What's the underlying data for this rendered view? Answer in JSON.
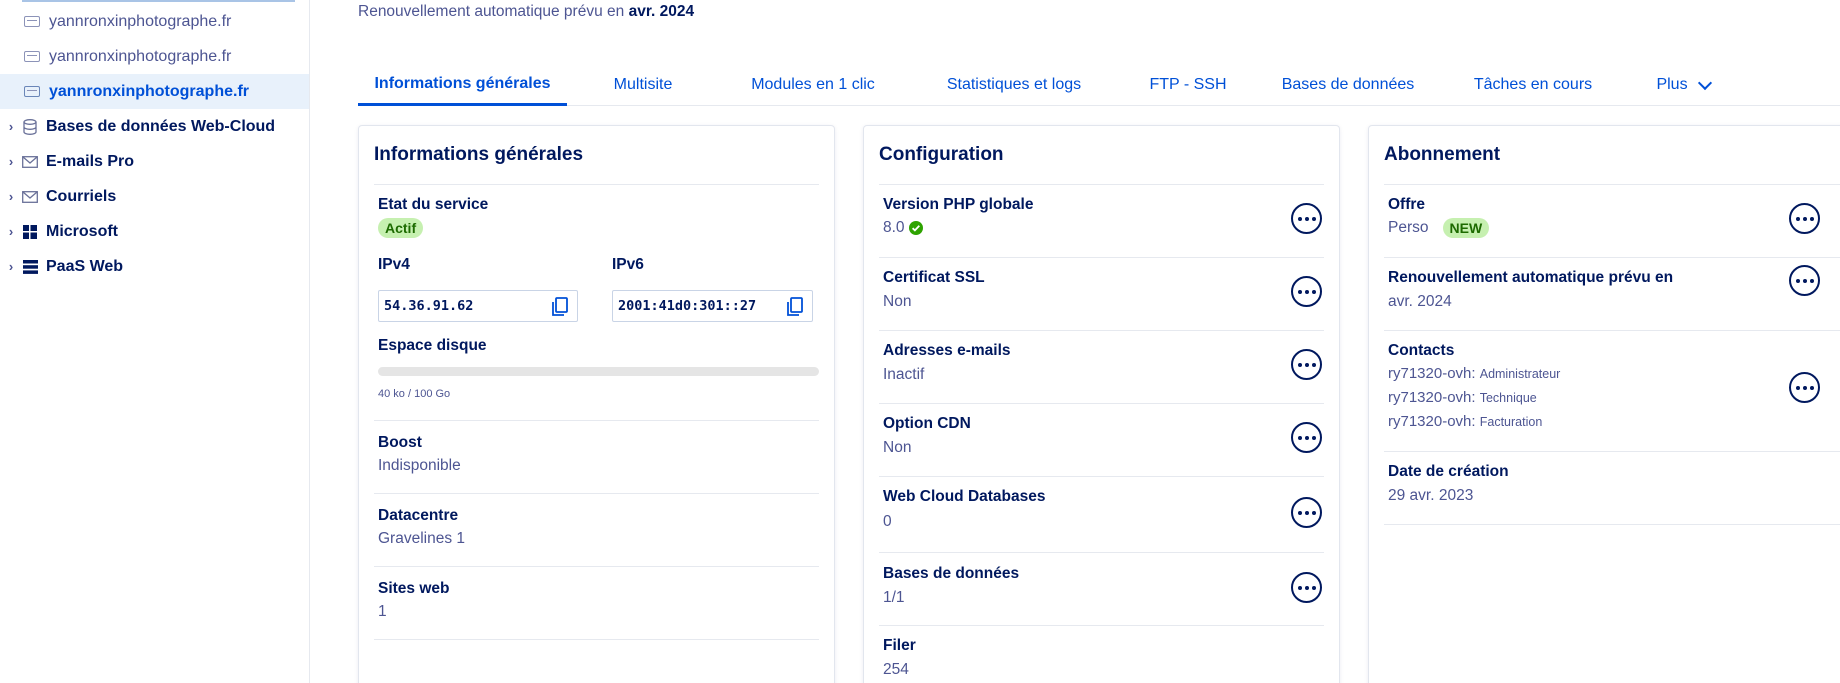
{
  "sidebar": {
    "sites": [
      {
        "label": "yannronxinphotographe.fr"
      },
      {
        "label": "yannronxinphotographe.fr"
      },
      {
        "label": "yannronxinphotographe.fr"
      }
    ],
    "nav": [
      {
        "label": "Bases de données Web-Cloud",
        "icon": "database-icon"
      },
      {
        "label": "E-mails Pro",
        "icon": "envelope-icon"
      },
      {
        "label": "Courriels",
        "icon": "envelope-icon"
      },
      {
        "label": "Microsoft",
        "icon": "windows-icon"
      },
      {
        "label": "PaaS Web",
        "icon": "server-stack-icon"
      }
    ]
  },
  "header": {
    "renew_text": "Renouvellement automatique prévu en",
    "renew_date": "avr. 2024"
  },
  "tabs": [
    {
      "label": "Informations générales",
      "active": true
    },
    {
      "label": "Multisite"
    },
    {
      "label": "Modules en 1 clic"
    },
    {
      "label": "Statistiques et logs"
    },
    {
      "label": "FTP - SSH"
    },
    {
      "label": "Bases de données"
    },
    {
      "label": "Tâches en cours"
    },
    {
      "label": "Plus"
    }
  ],
  "general": {
    "title": "Informations générales",
    "service_label": "Etat du service",
    "service_value": "Actif",
    "ipv4_label": "IPv4",
    "ipv4_value": "54.36.91.62",
    "ipv6_label": "IPv6",
    "ipv6_value": "2001:41d0:301::27",
    "disk_label": "Espace disque",
    "disk_usage": "40 ko / 100 Go",
    "disk_fraction": 0.0,
    "boost_label": "Boost",
    "boost_value": "Indisponible",
    "dc_label": "Datacentre",
    "dc_value": "Gravelines 1",
    "sites_label": "Sites web",
    "sites_value": "1"
  },
  "config": {
    "title": "Configuration",
    "php_label": "Version PHP globale",
    "php_value": "8.0",
    "ssl_label": "Certificat SSL",
    "ssl_value": "Non",
    "emails_label": "Adresses e-mails",
    "emails_value": "Inactif",
    "cdn_label": "Option CDN",
    "cdn_value": "Non",
    "wcdb_label": "Web Cloud Databases",
    "wcdb_value": "0",
    "db_label": "Bases de données",
    "db_value": "1/1",
    "filer_label": "Filer",
    "filer_value": "254"
  },
  "subscription": {
    "title": "Abonnement",
    "offer_label": "Offre",
    "offer_value": "Perso",
    "offer_badge": "NEW",
    "renew_label": "Renouvellement automatique prévu en",
    "renew_value": "avr. 2024",
    "contacts_label": "Contacts",
    "contacts": [
      {
        "id": "ry71320-ovh:",
        "role": "Administrateur"
      },
      {
        "id": "ry71320-ovh:",
        "role": "Technique"
      },
      {
        "id": "ry71320-ovh:",
        "role": "Facturation"
      }
    ],
    "created_label": "Date de création",
    "created_value": "29 avr. 2023"
  },
  "colors": {
    "primary": "#0050d7",
    "navy": "#00185e",
    "muted": "#4d5592",
    "badge_green_bg": "#c6f0b0",
    "check_green": "#2ea300"
  }
}
